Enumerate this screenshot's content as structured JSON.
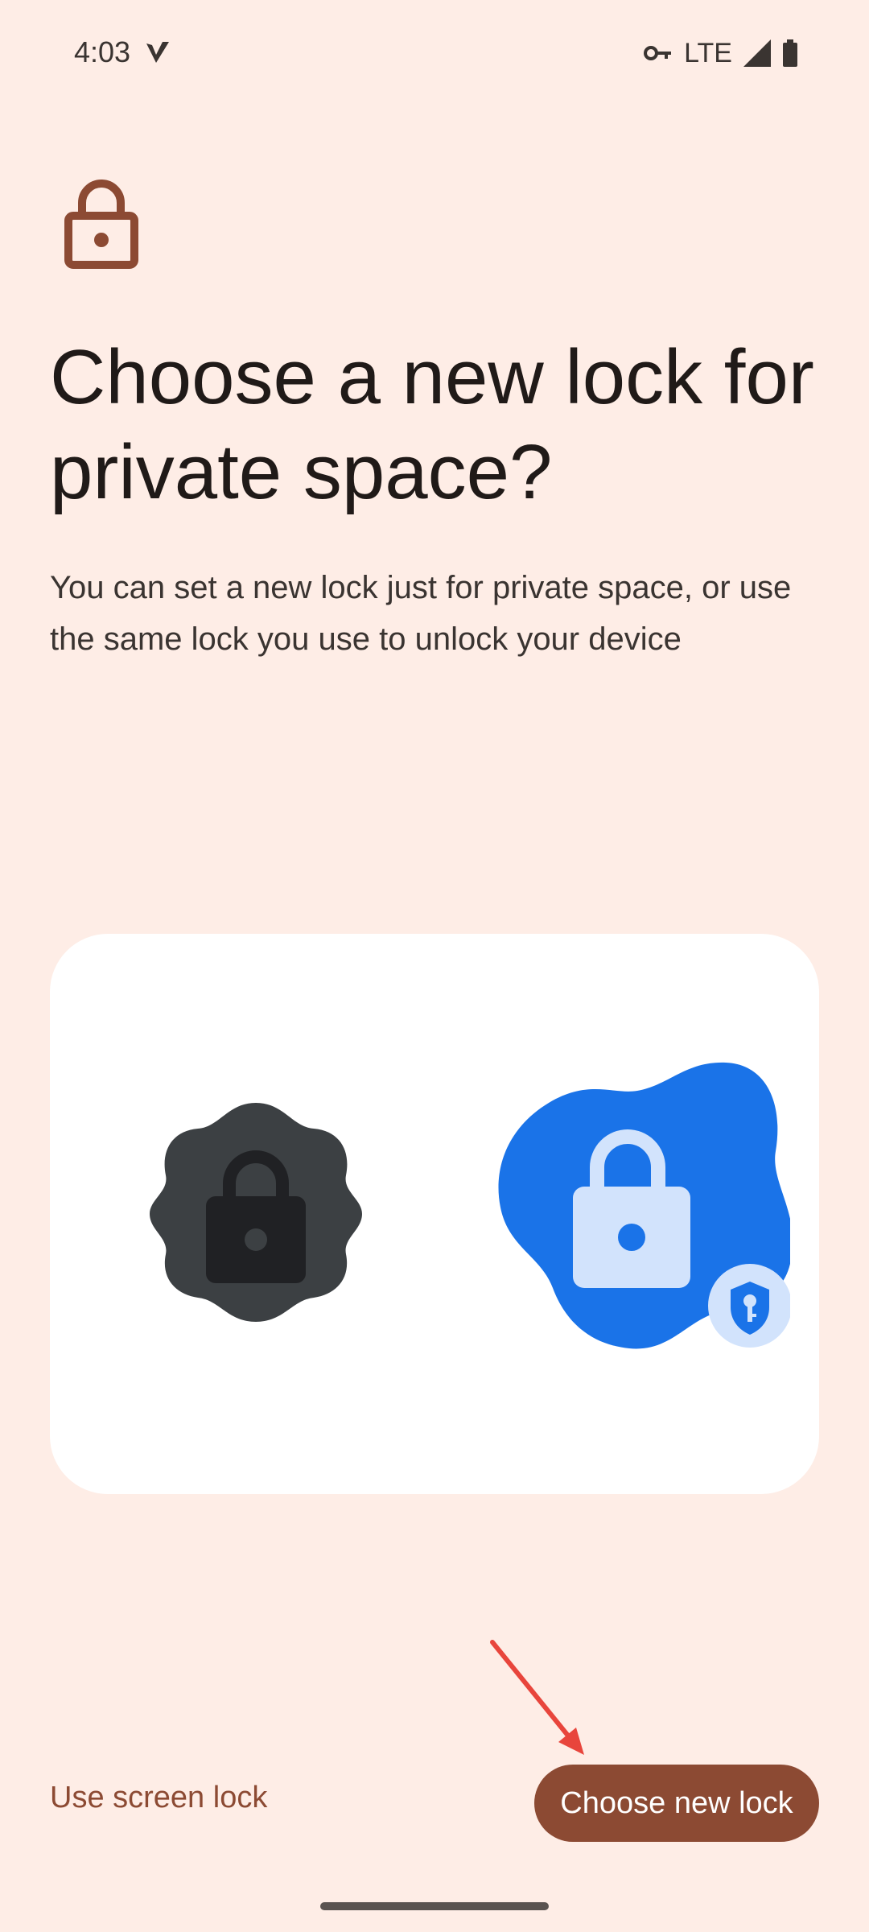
{
  "status_bar": {
    "time": "4:03",
    "network": "LTE",
    "icons": [
      "vpn-check-icon",
      "vpn-key-icon",
      "signal-icon",
      "battery-icon"
    ]
  },
  "header": {
    "icon": "lock-icon",
    "title": "Choose a new lock for private space?",
    "description": "You can set a new lock just for private space, or use the same lock you use to unlock your device"
  },
  "illustration": {
    "icons": [
      "device-lock-icon",
      "private-space-lock-icon",
      "shield-key-icon"
    ]
  },
  "footer": {
    "secondary_label": "Use screen lock",
    "primary_label": "Choose new lock"
  },
  "colors": {
    "background": "#FEEDE6",
    "accent": "#8C4A33",
    "blue": "#1A73E8",
    "light_blue": "#D2E3FC",
    "dark_gray": "#3C4043"
  }
}
